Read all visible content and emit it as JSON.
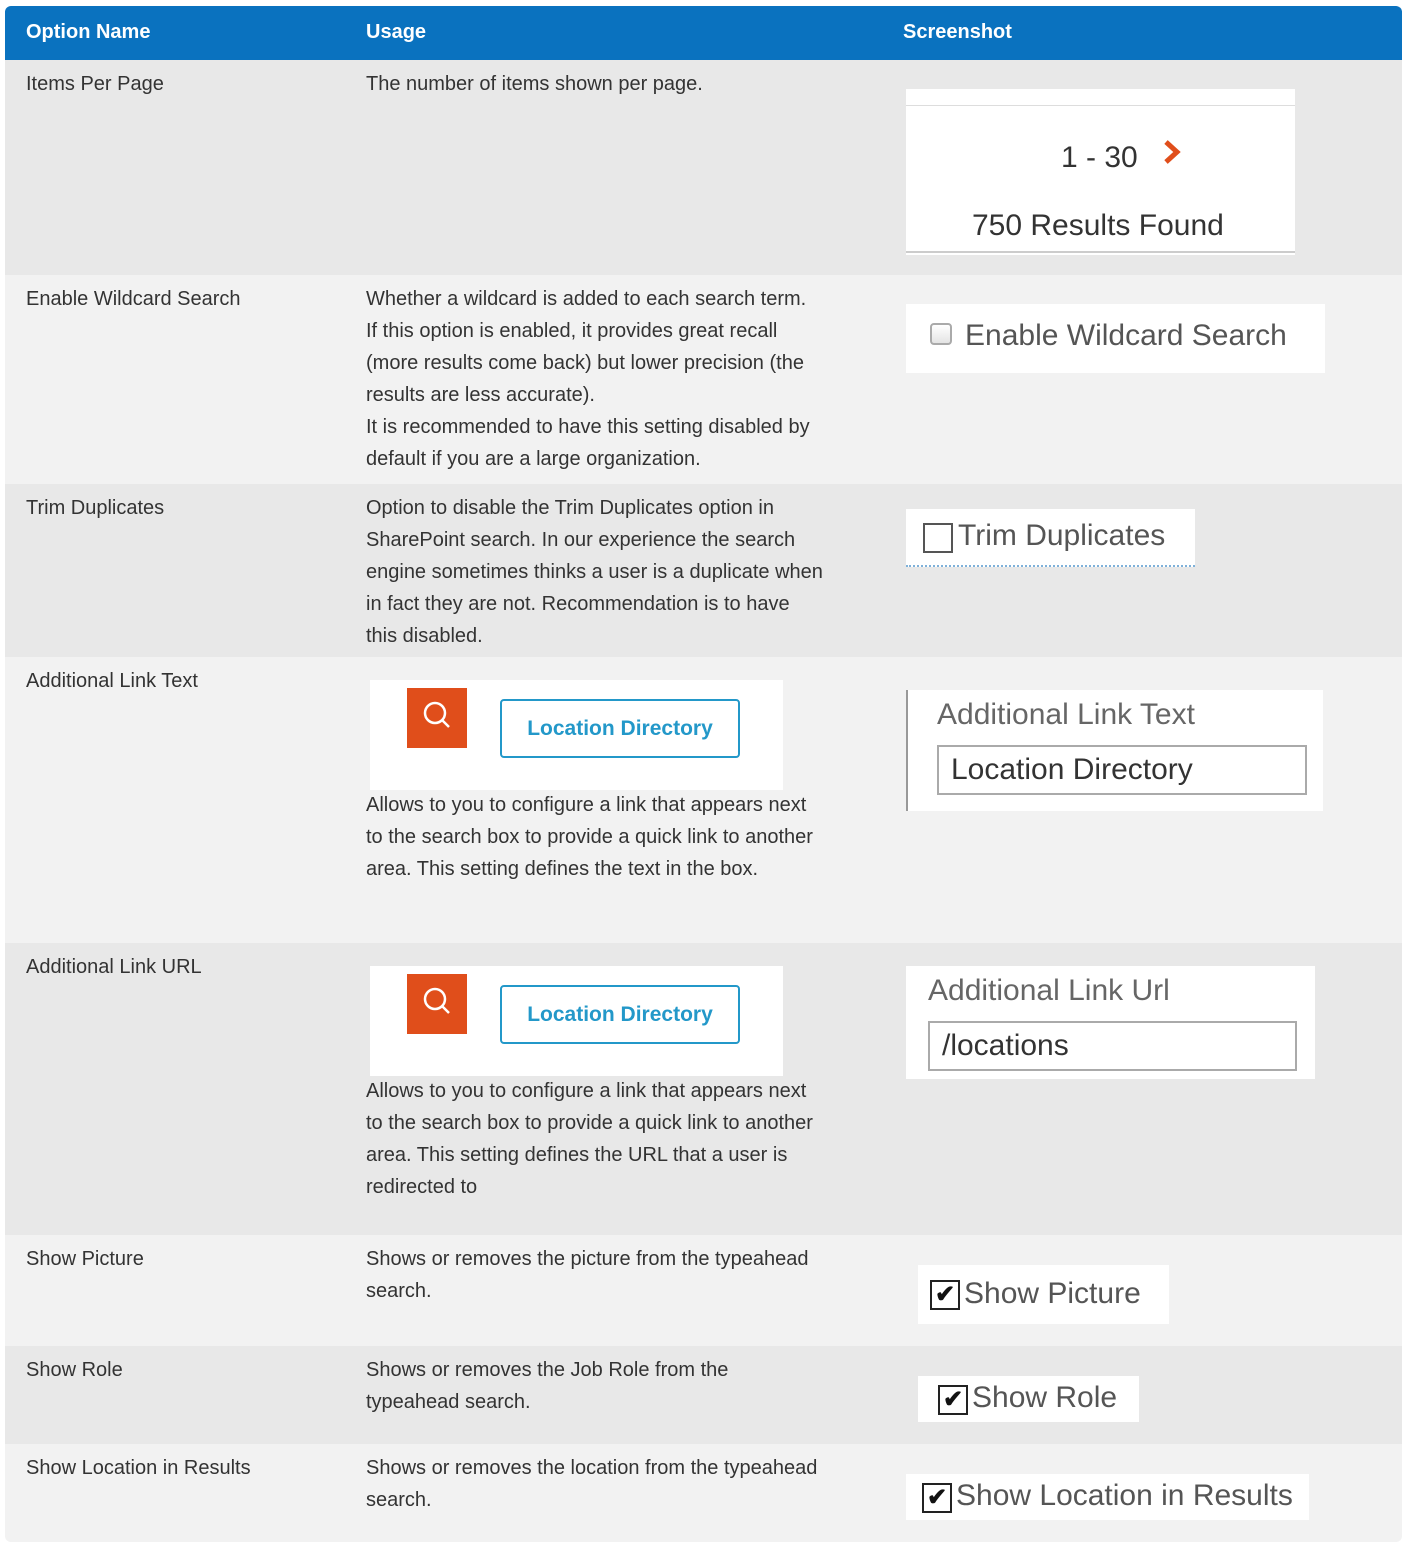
{
  "header": {
    "option_name": "Option Name",
    "usage": "Usage",
    "screenshot": "Screenshot"
  },
  "rows": [
    {
      "name": "Items Per Page",
      "usage": [
        "The number of items shown per page."
      ],
      "shot": {
        "range": "1 - 30",
        "arrow": "›",
        "found": "750 Results Found"
      }
    },
    {
      "name": "Enable Wildcard Search",
      "usage": [
        "Whether a wildcard is added to each search term.",
        "If this option is enabled, it provides great recall",
        "(more results come back) but lower precision (the",
        "results are less accurate).",
        "It is recommended to have this setting disabled by",
        "default if you are a large organization."
      ],
      "shot": {
        "label": "Enable Wildcard Search",
        "checked": false
      }
    },
    {
      "name": "Trim Duplicates",
      "usage": [
        "Option to disable the Trim Duplicates option in",
        "SharePoint search. In our experience the search",
        "engine sometimes thinks a user is a duplicate when",
        "in fact they are not. Recommendation is to have",
        "this disabled."
      ],
      "shot": {
        "label": "Trim Duplicates",
        "checked": false
      }
    },
    {
      "name": "Additional Link Text",
      "preview": {
        "link_label": "Location Directory"
      },
      "usage": [
        "Allows to you to configure a link that appears next",
        "to the search box to provide a quick link to another",
        "area. This setting defines the text in the box."
      ],
      "shot": {
        "field_label": "Additional Link Text",
        "field_value": "Location Directory"
      }
    },
    {
      "name": "Additional Link URL",
      "preview": {
        "link_label": "Location Directory"
      },
      "usage": [
        "Allows to you to configure a link that appears next",
        "to the search box to provide a quick link to another",
        "area. This setting defines the URL that a user is",
        "redirected to"
      ],
      "shot": {
        "field_label": "Additional Link Url",
        "field_value": "/locations"
      }
    },
    {
      "name": "Show Picture",
      "usage": [
        "Shows or removes the picture from the typeahead",
        "search."
      ],
      "shot": {
        "label": "Show Picture",
        "checked": true
      }
    },
    {
      "name": "Show Role",
      "usage": [
        "Shows or removes the Job Role from the",
        "typeahead search."
      ],
      "shot": {
        "label": "Show Role",
        "checked": true
      }
    },
    {
      "name": "Show Location in Results",
      "usage": [
        "Shows or removes the location from the typeahead",
        "search."
      ],
      "shot": {
        "label": "Show Location in Results",
        "checked": true
      }
    }
  ],
  "colors": {
    "header_bg": "#0a72bf",
    "accent_orange": "#e04e1b",
    "link_blue": "#2398c9"
  },
  "icons": {
    "search": "search-icon",
    "next": "chevron-right-icon",
    "checkmark": "✔"
  }
}
